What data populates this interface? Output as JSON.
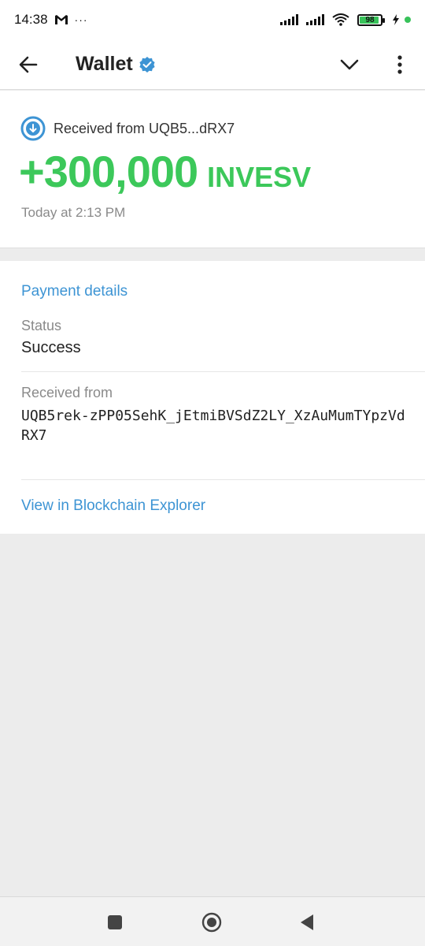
{
  "status_bar": {
    "time": "14:38",
    "mail_icon": "gmail-icon",
    "more_notifications": "···",
    "battery_percent": "98"
  },
  "app_bar": {
    "title": "Wallet",
    "verified_icon": "verified-badge-icon"
  },
  "transaction": {
    "received_label": "Received from UQB5...dRX7",
    "amount": "+300,000",
    "ticker": "INVESV",
    "timestamp": "Today at 2:13 PM",
    "accent_color": "#3cc85a"
  },
  "details": {
    "section_title": "Payment details",
    "status_label": "Status",
    "status_value": "Success",
    "from_label": "Received from",
    "from_address": "UQB5rek-zPP05SehK_jEtmiBVSdZ2LY_XzAuMumTYpzVdRX7",
    "explorer_link": "View in Blockchain Explorer",
    "link_color": "#3d94d4"
  },
  "nav_bar": {
    "items": [
      "recents-square-icon",
      "home-circle-icon",
      "back-triangle-icon"
    ]
  }
}
